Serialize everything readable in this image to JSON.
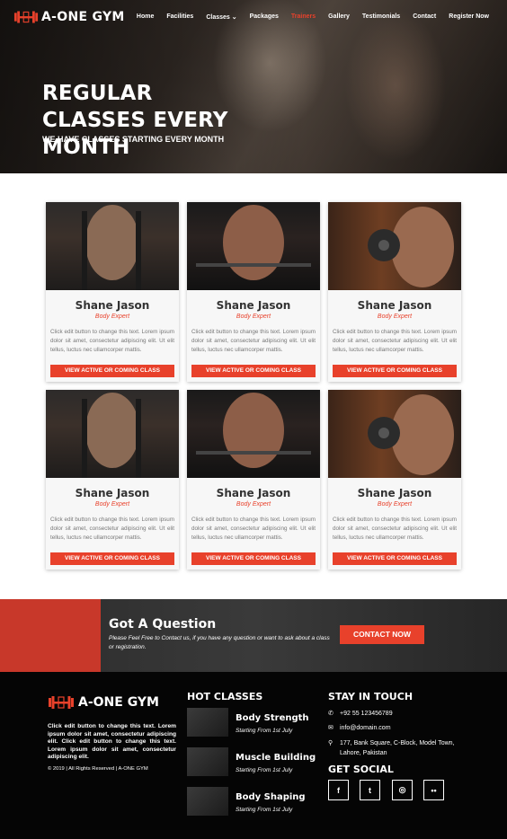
{
  "header": {
    "logo_text": "A-ONE GYM",
    "menu": [
      "Home",
      "Facilities",
      "Classes",
      "Packages",
      "Trainers",
      "Gallery",
      "Testimonials",
      "Contact",
      "Register Now"
    ],
    "active_index": 4
  },
  "hero": {
    "title": "REGULAR CLASSES EVERY MONTH",
    "subtitle": "WE HAVE CLASSES STARTING EVERY MONTH"
  },
  "trainers": [
    {
      "name": "Shane Jason",
      "role": "Body Expert",
      "desc": "Click edit button to change this text. Lorem ipsum dolor sit amet, consectetur adipiscing elit. Ut elit tellus, luctus nec ullamcorper mattis.",
      "button": "VIEW ACTIVE OR COMING CLASS"
    },
    {
      "name": "Shane Jason",
      "role": "Body Expert",
      "desc": "Click edit button to change this text. Lorem ipsum dolor sit amet, consectetur adipiscing elit. Ut elit tellus, luctus nec ullamcorper mattis.",
      "button": "VIEW ACTIVE OR COMING CLASS"
    },
    {
      "name": "Shane Jason",
      "role": "Body Expert",
      "desc": "Click edit button to change this text. Lorem ipsum dolor sit amet, consectetur adipiscing elit. Ut elit tellus, luctus nec ullamcorper mattis.",
      "button": "VIEW ACTIVE OR COMING CLASS"
    },
    {
      "name": "Shane Jason",
      "role": "Body Expert",
      "desc": "Click edit button to change this text. Lorem ipsum dolor sit amet, consectetur adipiscing elit. Ut elit tellus, luctus nec ullamcorper mattis.",
      "button": "VIEW ACTIVE OR COMING CLASS"
    },
    {
      "name": "Shane Jason",
      "role": "Body Expert",
      "desc": "Click edit button to change this text. Lorem ipsum dolor sit amet, consectetur adipiscing elit. Ut elit tellus, luctus nec ullamcorper mattis.",
      "button": "VIEW ACTIVE OR COMING CLASS"
    },
    {
      "name": "Shane Jason",
      "role": "Body Expert",
      "desc": "Click edit button to change this text. Lorem ipsum dolor sit amet, consectetur adipiscing elit. Ut elit tellus, luctus nec ullamcorper mattis.",
      "button": "VIEW ACTIVE OR COMING CLASS"
    }
  ],
  "cta": {
    "title": "Got A Question",
    "text": "Please Feel Free to Contact us, if you have any question or want to ask about a class or registration.",
    "button": "CONTACT NOW"
  },
  "footer": {
    "logo_text": "A-ONE GYM",
    "about": "Click edit button to change this text. Lorem ipsum dolor sit amet, consectetur adipiscing elit. Click edit button to change this text. Lorem ipsum dolor sit amet, consectetur adipiscing elit.",
    "copyright": "© 2019 | All Rights Reserved | A-ONE GYM",
    "hot_classes_title": "HOT CLASSES",
    "hot_classes": [
      {
        "name": "Body Strength",
        "date": "Starting From 1st July"
      },
      {
        "name": "Muscle Building",
        "date": "Starting From 1st July"
      },
      {
        "name": "Body Shaping",
        "date": "Starting From 1st July"
      }
    ],
    "contact_title": "STAY IN TOUCH",
    "phone": "+92 55 123456789",
    "email": "info@domain.com",
    "address_line1": "177, Bank Square, C-Block, Model Town,",
    "address_line2": "Lahore, Pakistan",
    "social_title": "GET SOCIAL",
    "social_icons": [
      "facebook-icon",
      "twitter-icon",
      "instagram-icon",
      "flickr-icon"
    ]
  },
  "colors": {
    "accent": "#e8412b",
    "cta_red": "#c8382a",
    "footer_bg": "#050505"
  }
}
